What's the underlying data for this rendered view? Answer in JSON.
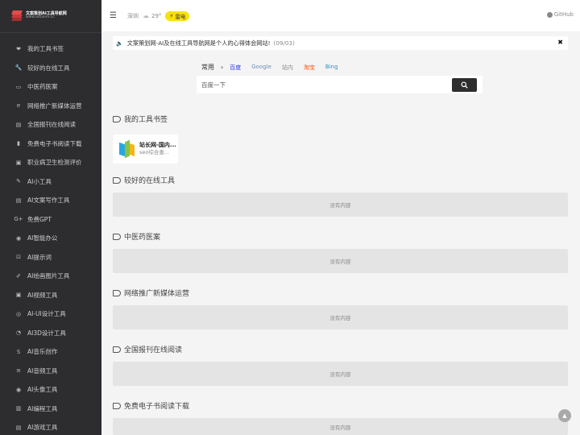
{
  "sidebar": {
    "logo_title": "文案策划AI工具导航网",
    "logo_url": "www.aitumm.cc",
    "items": [
      {
        "label": "我的工具书签",
        "icon": "heart-icon",
        "glyph": "❤"
      },
      {
        "label": "较好的在线工具",
        "icon": "wrench-icon",
        "glyph": "🔧"
      },
      {
        "label": "中医药医案",
        "icon": "folder-icon",
        "glyph": "▭"
      },
      {
        "label": "网络推广新媒体运营",
        "icon": "edge-icon",
        "glyph": "e"
      },
      {
        "label": "全国报刊在线阅读",
        "icon": "newspaper-icon",
        "glyph": "▤"
      },
      {
        "label": "免费电子书阅读下载",
        "icon": "book-icon",
        "glyph": "▮"
      },
      {
        "label": "职业病卫生检测评价",
        "icon": "clipboard-icon",
        "glyph": "▣"
      },
      {
        "label": "AI小工具",
        "icon": "tool-icon",
        "glyph": "✎"
      },
      {
        "label": "AI文案写作工具",
        "icon": "document-icon",
        "glyph": "▤"
      },
      {
        "label": "免费GPT",
        "icon": "google-plus-icon",
        "glyph": "G+"
      },
      {
        "label": "AI智能办公",
        "icon": "chrome-icon",
        "glyph": "◉"
      },
      {
        "label": "AI提示词",
        "icon": "prompt-icon",
        "glyph": "⊡"
      },
      {
        "label": "AI绘画图片工具",
        "icon": "brush-icon",
        "glyph": "✐"
      },
      {
        "label": "AI视频工具",
        "icon": "video-icon",
        "glyph": "▣"
      },
      {
        "label": "AI-UI设计工具",
        "icon": "globe-icon",
        "glyph": "◎"
      },
      {
        "label": "AI3D设计工具",
        "icon": "pie-icon",
        "glyph": "◔"
      },
      {
        "label": "AI音乐创作",
        "icon": "dollar-icon",
        "glyph": "S"
      },
      {
        "label": "AI音频工具",
        "icon": "audio-icon",
        "glyph": "≡"
      },
      {
        "label": "AI头像工具",
        "icon": "avatar-icon",
        "glyph": "◉"
      },
      {
        "label": "AI编程工具",
        "icon": "code-icon",
        "glyph": "▥"
      },
      {
        "label": "AI游戏工具",
        "icon": "game-icon",
        "glyph": "▤"
      }
    ]
  },
  "topbar": {
    "city": "深圳",
    "temp": "29°",
    "alert": "雷电",
    "github": "GitHub"
  },
  "notice": {
    "text": "文案策划网-AI及在线工具导航网是个人的心得体会网站!",
    "date": "(09/03)"
  },
  "search": {
    "category": "常用",
    "engines": [
      {
        "label": "百度",
        "color": "#2932e1"
      },
      {
        "label": "Google",
        "color": "#6f8fb0"
      },
      {
        "label": "站内",
        "color": "#888888"
      },
      {
        "label": "淘宝",
        "color": "#ff5000"
      },
      {
        "label": "Bing",
        "color": "#2f8fbf"
      }
    ],
    "placeholder": "百度一下"
  },
  "sections": [
    {
      "title": "我的工具书签"
    },
    {
      "title": "较好的在线工具",
      "empty": "没有内容"
    },
    {
      "title": "中医药医案",
      "empty": "没有内容"
    },
    {
      "title": "网络推广新媒体运营",
      "empty": "没有内容"
    },
    {
      "title": "全国报刊在线阅读",
      "empty": "没有内容"
    },
    {
      "title": "免费电子书阅读下载",
      "empty": "没有内容"
    }
  ],
  "bookmark": {
    "title": "站长网-国内...",
    "desc": "seo综合查..."
  }
}
